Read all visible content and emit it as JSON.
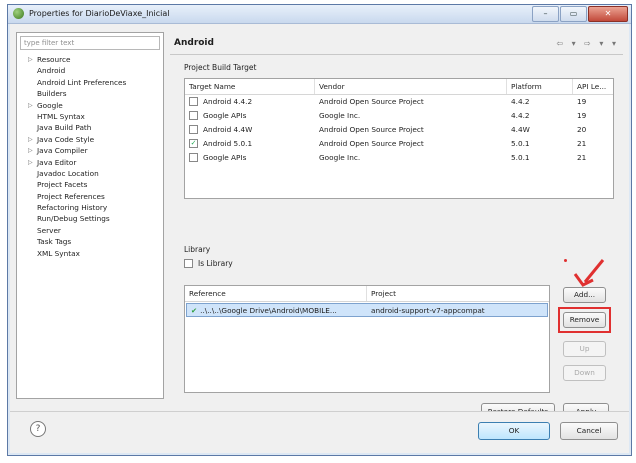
{
  "window": {
    "title": "Properties for DiarioDeViaxe_Inicial",
    "controls": {
      "minimize": "–",
      "maximize": "▭",
      "close": "✕"
    }
  },
  "sidebar": {
    "filter_placeholder": "type filter text",
    "items": [
      {
        "label": "Resource",
        "expandable": true
      },
      {
        "label": "Android",
        "expandable": false
      },
      {
        "label": "Android Lint Preferences",
        "expandable": false
      },
      {
        "label": "Builders",
        "expandable": false
      },
      {
        "label": "Google",
        "expandable": true
      },
      {
        "label": "HTML Syntax",
        "expandable": false
      },
      {
        "label": "Java Build Path",
        "expandable": false
      },
      {
        "label": "Java Code Style",
        "expandable": true
      },
      {
        "label": "Java Compiler",
        "expandable": true
      },
      {
        "label": "Java Editor",
        "expandable": true
      },
      {
        "label": "Javadoc Location",
        "expandable": false
      },
      {
        "label": "Project Facets",
        "expandable": false
      },
      {
        "label": "Project References",
        "expandable": false
      },
      {
        "label": "Refactoring History",
        "expandable": false
      },
      {
        "label": "Run/Debug Settings",
        "expandable": false
      },
      {
        "label": "Server",
        "expandable": false
      },
      {
        "label": "Task Tags",
        "expandable": false
      },
      {
        "label": "XML Syntax",
        "expandable": false
      }
    ]
  },
  "page": {
    "title": "Android",
    "build_target": {
      "label": "Project Build Target",
      "columns": [
        "Target Name",
        "Vendor",
        "Platform",
        "API Le..."
      ],
      "rows": [
        {
          "checked": false,
          "name": "Android 4.4.2",
          "vendor": "Android Open Source Project",
          "platform": "4.4.2",
          "api": "19"
        },
        {
          "checked": false,
          "name": "Google APIs",
          "vendor": "Google Inc.",
          "platform": "4.4.2",
          "api": "19"
        },
        {
          "checked": false,
          "name": "Android 4.4W",
          "vendor": "Android Open Source Project",
          "platform": "4.4W",
          "api": "20"
        },
        {
          "checked": true,
          "name": "Android 5.0.1",
          "vendor": "Android Open Source Project",
          "platform": "5.0.1",
          "api": "21"
        },
        {
          "checked": false,
          "name": "Google APIs",
          "vendor": "Google Inc.",
          "platform": "5.0.1",
          "api": "21"
        }
      ]
    },
    "library": {
      "label": "Library",
      "is_library_label": "Is Library",
      "is_library_checked": false,
      "columns": [
        "Reference",
        "Project"
      ],
      "rows": [
        {
          "reference": "..\\..\\..\\Google Drive\\Android\\MOBILE...",
          "project": "android-support-v7-appcompat"
        }
      ],
      "buttons": {
        "add": "Add...",
        "remove": "Remove",
        "up": "Up",
        "down": "Down"
      }
    },
    "restore_defaults": "Restore Defaults",
    "apply": "Apply"
  },
  "footer": {
    "help": "?",
    "ok": "OK",
    "cancel": "Cancel"
  },
  "colors": {
    "highlight": "#e03030",
    "selection": "#cfe4fa"
  }
}
